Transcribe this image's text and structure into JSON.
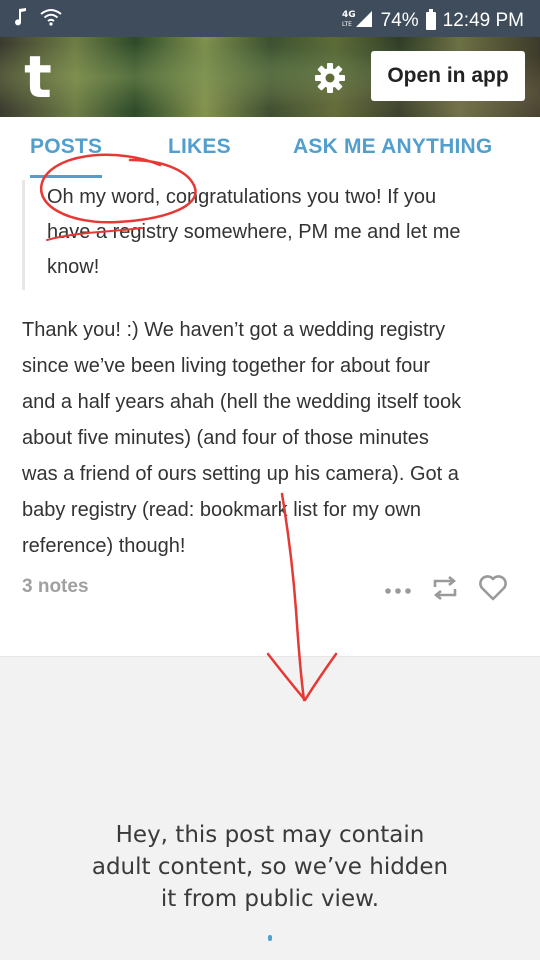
{
  "status_bar": {
    "left_icons": [
      "music-note-icon",
      "wifi-icon"
    ],
    "network": "4G LTE",
    "battery": "74%",
    "time": "12:49 PM"
  },
  "header": {
    "logo": "t",
    "settings_icon": "gear-icon",
    "open_app_label": "Open in app"
  },
  "tabs": [
    {
      "label": "POSTS",
      "active": true
    },
    {
      "label": "LIKES",
      "active": false
    },
    {
      "label": "ASK ME ANYTHING",
      "active": false
    }
  ],
  "post": {
    "quote_lines": [
      "Oh my word, congratulations you two! If you",
      "have a registry somewhere, PM me and let me",
      "know!"
    ],
    "body_lines": [
      "Thank you! :) We haven’t got a wedding registry",
      "since we’ve been living together for about four",
      "and a half years ahah (hell the wedding itself took",
      "about five minutes) (and four of those minutes",
      "was a friend of ours setting up his camera). Got a",
      "baby registry (read: bookmark list for my own",
      "reference) though!"
    ],
    "notes": "3 notes",
    "actions": [
      "more-icon",
      "reblog-icon",
      "heart-icon"
    ]
  },
  "hidden_notice": {
    "lines": [
      "Hey, this post may contain",
      "adult content, so we’ve hidden",
      "it from public view."
    ]
  },
  "colors": {
    "status_bar": "#3f4c5c",
    "accent": "#529ecc",
    "annotation": "#e53935",
    "hidden_bg": "#f2f2f2"
  }
}
